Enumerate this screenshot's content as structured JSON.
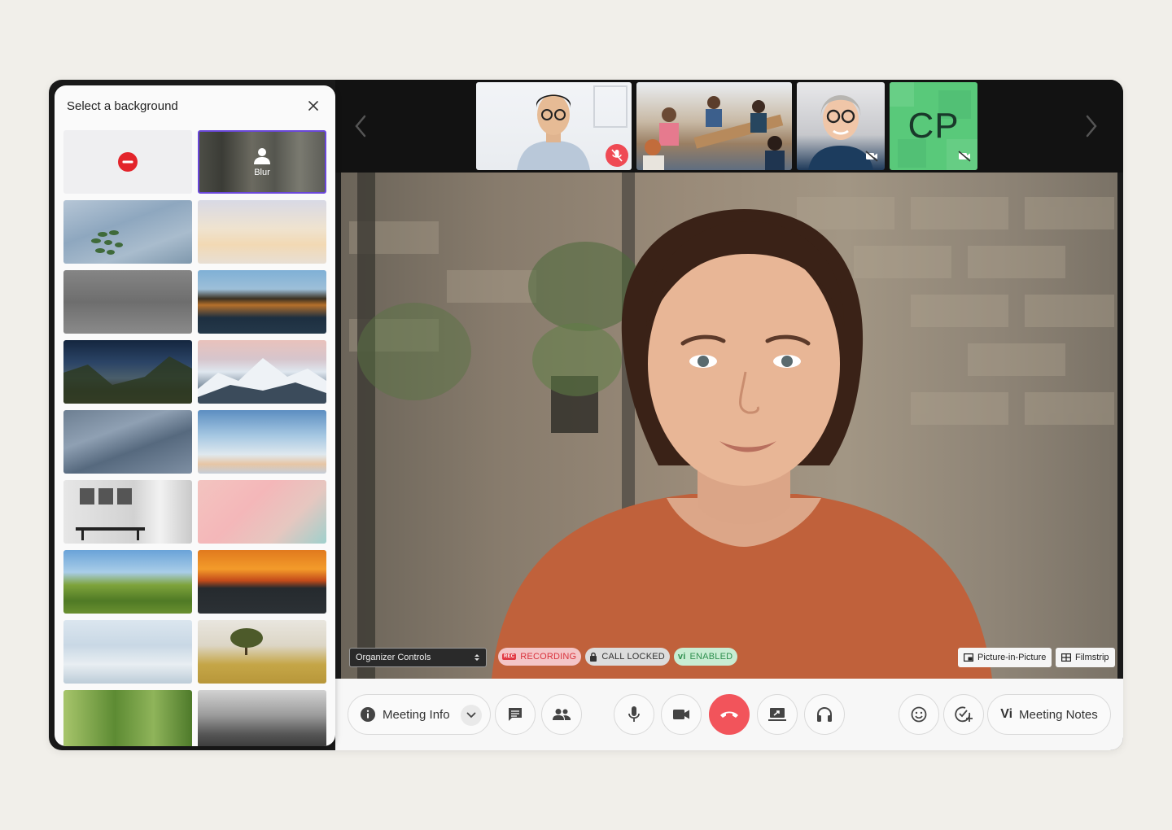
{
  "background_panel": {
    "title": "Select a background",
    "blur_label": "Blur"
  },
  "filmstrip": {
    "participant_initials": "CP"
  },
  "main_video": {
    "organizer_controls_label": "Organizer Controls",
    "rec_chip": "REC",
    "recording_label": "RECORDING",
    "call_locked_label": "CALL LOCKED",
    "vi_mark": "vi",
    "enabled_label": "ENABLED",
    "pip_label": "Picture-in-Picture",
    "filmstrip_label": "Filmstrip"
  },
  "control_bar": {
    "meeting_info_label": "Meeting Info",
    "vi_mark": "Vi",
    "meeting_notes_label": "Meeting Notes"
  },
  "colors": {
    "page_background": "#f1efea",
    "selected_tile_border": "#6a47d9",
    "end_call": "#f2545b",
    "muted_badge": "#ef4a54",
    "recording_pill": "#f4c5c7",
    "enabled_pill": "#c8ecd2",
    "avatar_tile": "#59c97a"
  }
}
